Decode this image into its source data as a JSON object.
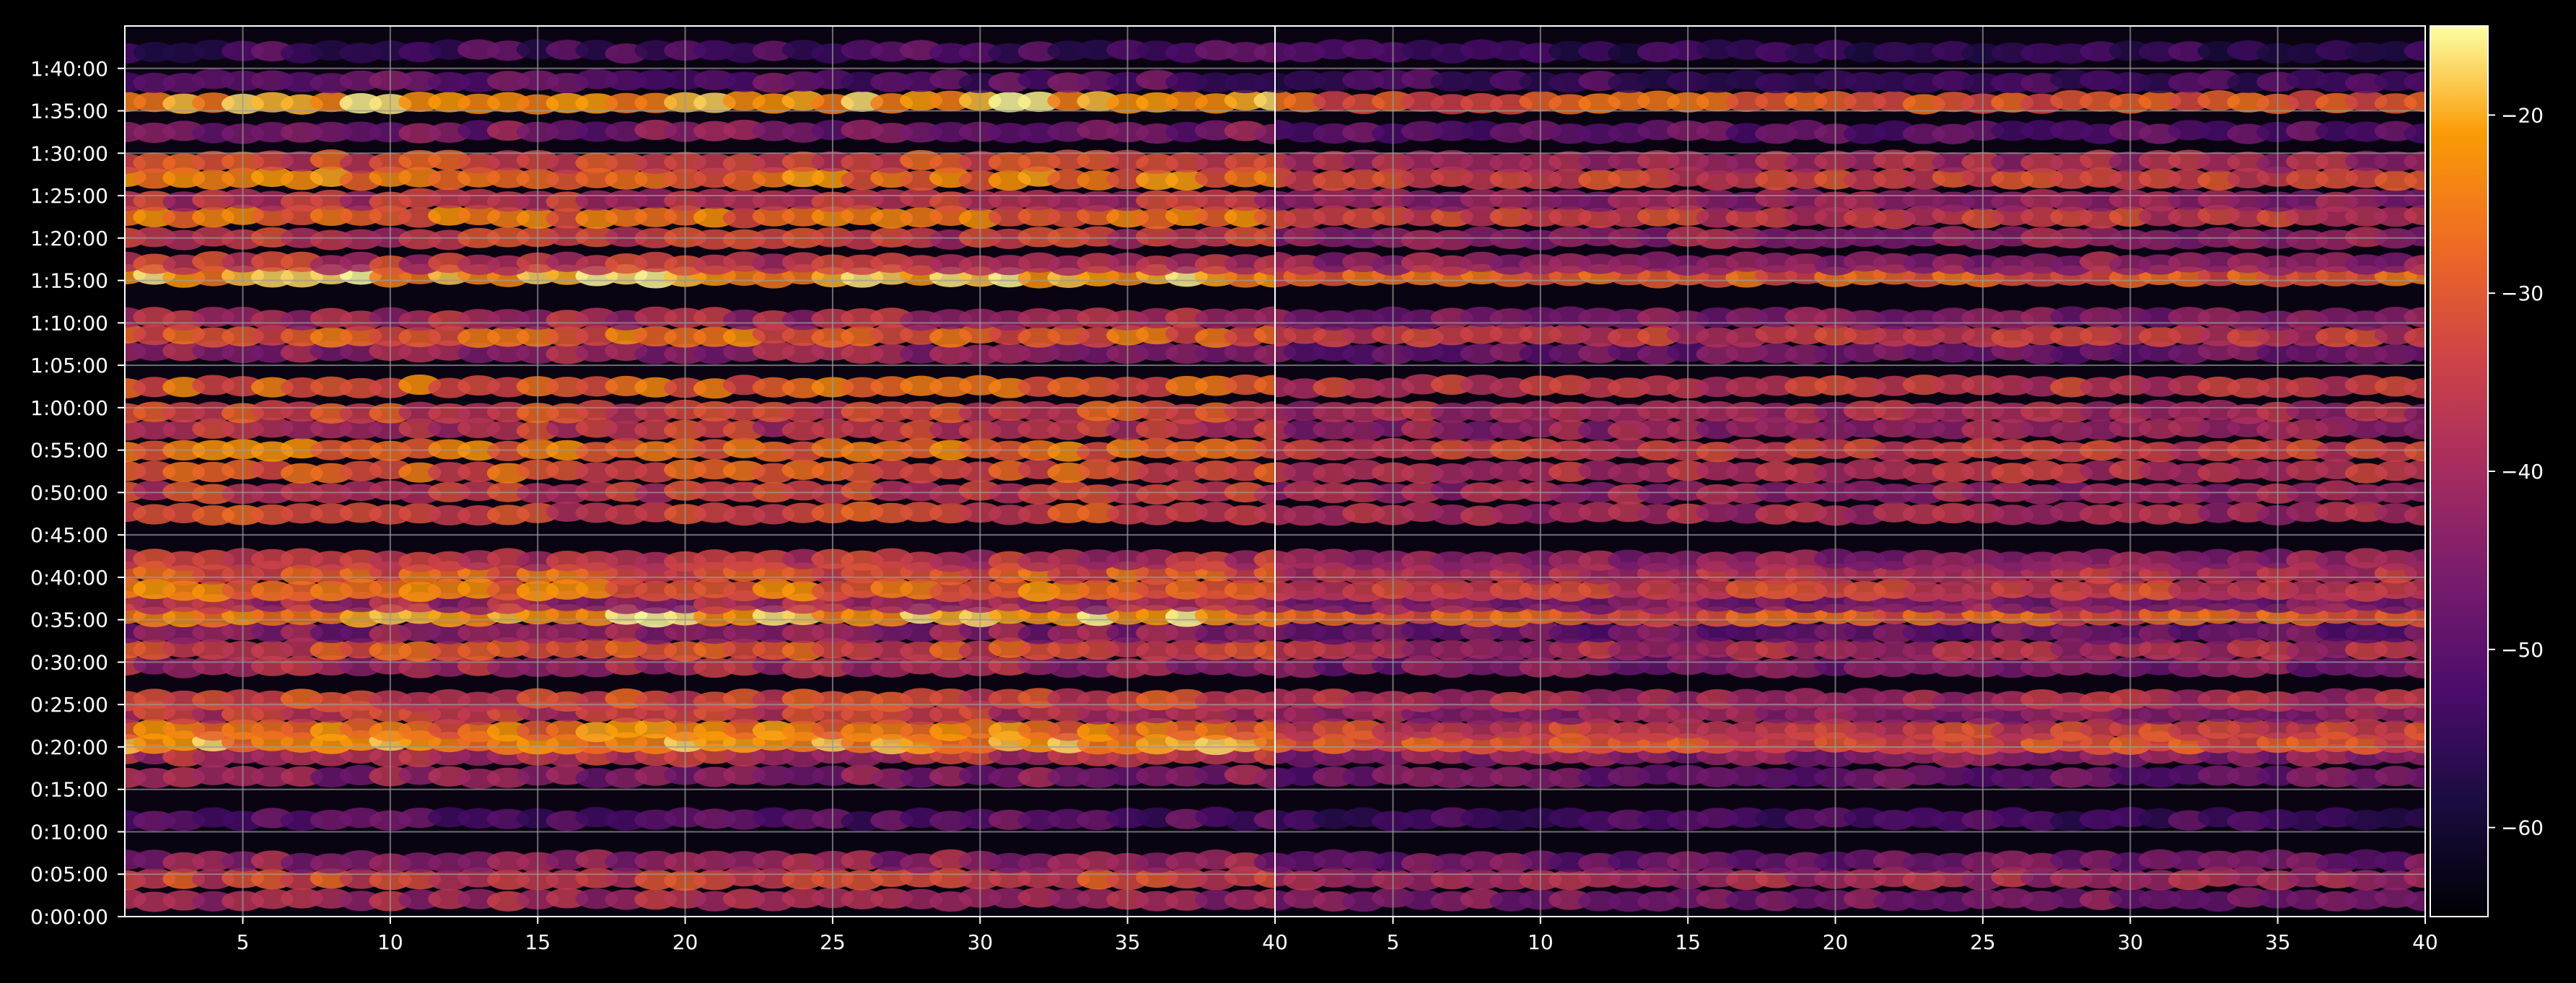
{
  "chart_data": {
    "type": "heatmap",
    "title": "",
    "xlabel": "",
    "ylabel": "",
    "colormap": "inferno",
    "colors": {
      "background": "#000000",
      "grid": "#9a9a9a",
      "text": "#ffffff",
      "axes": "#ffffff"
    },
    "grid": true,
    "panels": [
      {
        "name": "",
        "xlim": [
          1,
          40
        ],
        "xticks": [
          5,
          10,
          15,
          20,
          25,
          30,
          35,
          40
        ],
        "level_scale": 1.0
      },
      {
        "name": "",
        "xlim": [
          1,
          40
        ],
        "xticks": [
          5,
          10,
          15,
          20,
          25,
          30,
          35,
          40
        ],
        "level_scale": 0.8
      }
    ],
    "y_ticks": [
      "0:00:00",
      "0:05:00",
      "0:10:00",
      "0:15:00",
      "0:20:00",
      "0:25:00",
      "0:30:00",
      "0:35:00",
      "0:40:00",
      "0:45:00",
      "0:50:00",
      "0:55:00",
      "1:00:00",
      "1:05:00",
      "1:10:00",
      "1:15:00",
      "1:20:00",
      "1:25:00",
      "1:30:00",
      "1:35:00",
      "1:40:00"
    ],
    "y_range_minutes": [
      0,
      105
    ],
    "colorbar": {
      "range": [
        -65,
        -15
      ],
      "ticks": [
        -20,
        -30,
        -40,
        -50,
        -60
      ],
      "tick_labels": [
        "−20",
        "−30",
        "−40",
        "−50",
        "−60"
      ]
    },
    "bands": [
      {
        "minute": 2.0,
        "level": -40
      },
      {
        "minute": 4.5,
        "level": -33
      },
      {
        "minute": 6.5,
        "level": -42
      },
      {
        "minute": 11.5,
        "level": -50
      },
      {
        "minute": 16.5,
        "level": -43
      },
      {
        "minute": 19.0,
        "level": -38
      },
      {
        "minute": 20.5,
        "level": -22
      },
      {
        "minute": 22.0,
        "level": -26
      },
      {
        "minute": 24.0,
        "level": -36
      },
      {
        "minute": 25.5,
        "level": -32
      },
      {
        "minute": 29.5,
        "level": -40
      },
      {
        "minute": 31.5,
        "level": -32
      },
      {
        "minute": 33.5,
        "level": -43
      },
      {
        "minute": 35.5,
        "level": -21
      },
      {
        "minute": 37.0,
        "level": -40
      },
      {
        "minute": 38.5,
        "level": -26
      },
      {
        "minute": 40.5,
        "level": -30
      },
      {
        "minute": 42.0,
        "level": -37
      },
      {
        "minute": 47.5,
        "level": -33
      },
      {
        "minute": 50.0,
        "level": -35
      },
      {
        "minute": 52.5,
        "level": -30
      },
      {
        "minute": 55.0,
        "level": -27
      },
      {
        "minute": 57.5,
        "level": -36
      },
      {
        "minute": 59.5,
        "level": -33
      },
      {
        "minute": 62.5,
        "level": -28
      },
      {
        "minute": 66.5,
        "level": -42
      },
      {
        "minute": 68.5,
        "level": -28
      },
      {
        "minute": 70.5,
        "level": -39
      },
      {
        "minute": 75.5,
        "level": -21
      },
      {
        "minute": 77.0,
        "level": -36
      },
      {
        "minute": 80.0,
        "level": -36
      },
      {
        "minute": 82.5,
        "level": -27
      },
      {
        "minute": 84.5,
        "level": -37
      },
      {
        "minute": 87.0,
        "level": -26
      },
      {
        "minute": 89.0,
        "level": -33
      },
      {
        "minute": 92.5,
        "level": -45
      },
      {
        "minute": 96.0,
        "level": -21
      },
      {
        "minute": 98.5,
        "level": -50
      },
      {
        "minute": 102.0,
        "level": -52
      }
    ]
  }
}
